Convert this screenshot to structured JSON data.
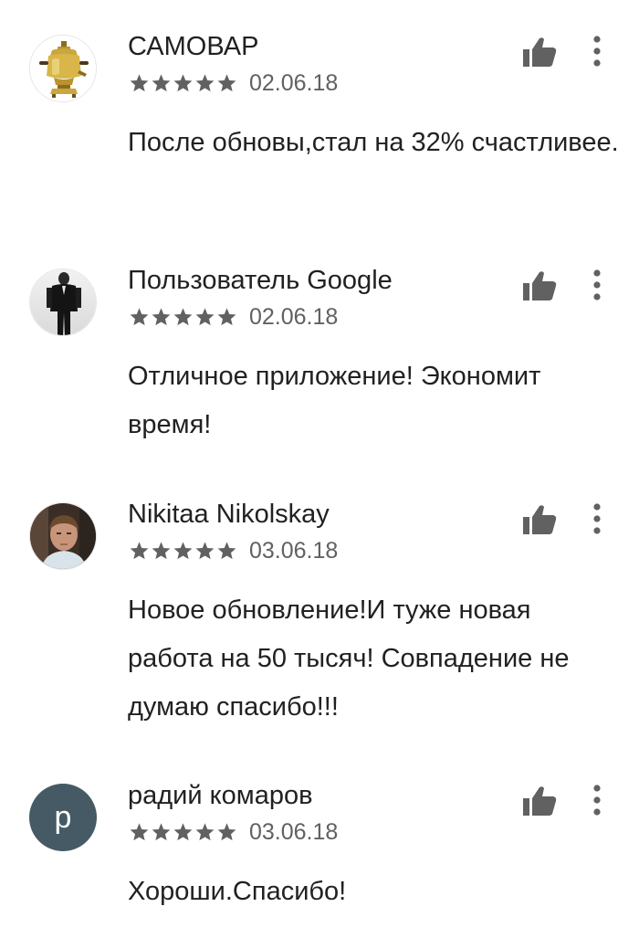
{
  "reviews": [
    {
      "author": "САМОВАР",
      "avatar": "samovar-image",
      "rating": 5,
      "date": "02.06.18",
      "text": "После обновы,стал на 32% счастливее."
    },
    {
      "author": "Пользователь Google",
      "avatar": "person-in-suit-image",
      "rating": 5,
      "date": "02.06.18",
      "text": "Отличное приложение! Экономит время!"
    },
    {
      "author": "Nikitaa Nikolskay",
      "avatar": "person-photo",
      "rating": 5,
      "date": "03.06.18",
      "text": "Новое обновление!И туже новая работа на 50 тысяч! Совпадение не думаю спасибо!!!"
    },
    {
      "author": "радий комаров",
      "avatar": "letter-avatar",
      "avatar_letter": "p",
      "avatar_color": "#455a64",
      "rating": 5,
      "date": "03.06.18",
      "text": "Хороши.Спасибо!"
    }
  ],
  "icons": {
    "helpful": "thumbs-up-icon",
    "menu": "more-vert-icon",
    "rating": "star-icon"
  },
  "colors": {
    "text": "#212121",
    "secondary_text": "#616161",
    "icon": "#616161",
    "star": "#616161"
  }
}
